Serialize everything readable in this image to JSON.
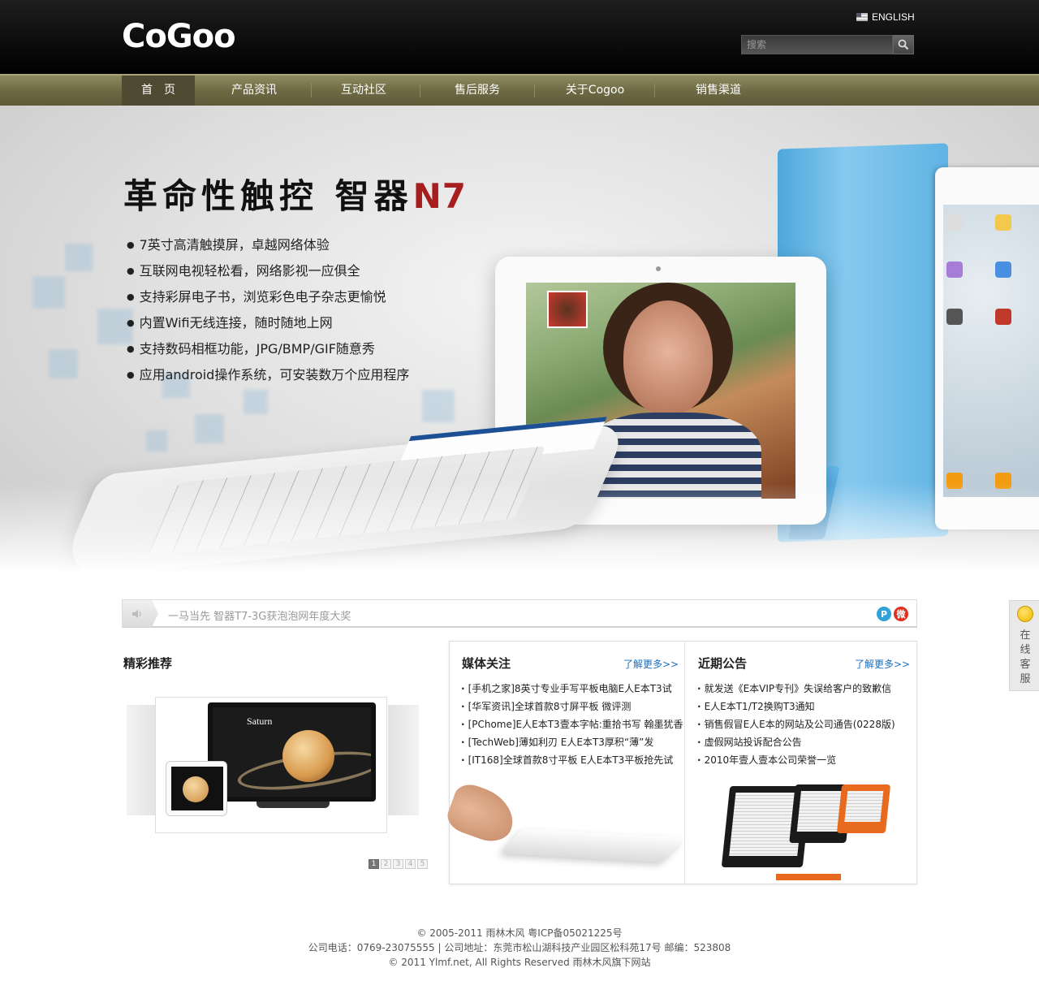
{
  "header": {
    "logo": "CoGoo",
    "language": "ENGLISH",
    "search_placeholder": "搜索"
  },
  "nav": {
    "items": [
      "首　页",
      "产品资讯",
      "互动社区",
      "售后服务",
      "关于Cogoo",
      "销售渠道"
    ],
    "active_index": 0
  },
  "banner": {
    "headline_main": "革命性触控 智器",
    "headline_model": "N7",
    "features": [
      "7英寸高清触摸屏，卓越网络体验",
      "互联网电视轻松看，网络影视一应俱全",
      "支持彩屏电子书，浏览彩色电子杂志更愉悦",
      "内置Wifi无线连接，随时随地上网",
      "支持数码相框功能，JPG/BMP/GIF随意秀",
      "应用android操作系统，可安装数万个应用程序"
    ],
    "slide_count": 3,
    "active_slide": 1
  },
  "ticker": {
    "text": "一马当先 智器T7-3G获泡泡网年度大奖"
  },
  "recommend": {
    "title": "精彩推荐",
    "image_label": "Saturn",
    "pages": [
      "1",
      "2",
      "3",
      "4",
      "5"
    ],
    "active_page": 1
  },
  "media": {
    "title": "媒体关注",
    "more": "了解更多>>",
    "items": [
      "[手机之家]8英寸专业手写平板电脑E人E本T3试",
      "[华军资讯]全球首款8寸屏平板 微评测",
      "[PChome]E人E本T3壹本字帖:重拾书写 翰墨犹香",
      "[TechWeb]薄如利刃 E人E本T3厚积“薄”发",
      "[IT168]全球首款8寸平板 E人E本T3平板抢先试"
    ]
  },
  "notices": {
    "title": "近期公告",
    "more": "了解更多>>",
    "items": [
      "就发送《E本VIP专刊》失误给客户的致歉信",
      "E人E本T1/T2换购T3通知",
      "销售假冒E人E本的网站及公司通告(0228版)",
      "虚假网站投诉配合公告",
      "2010年壹人壹本公司荣誉一览"
    ]
  },
  "side_service": {
    "label": "在线客服"
  },
  "footer": {
    "line1": "© 2005-2011 雨林木风 粤ICP备05021225号",
    "line2": "公司电话：0769-23075555 | 公司地址：东莞市松山湖科技产业园区松科苑17号 邮编：523808",
    "line3": "© 2011 Ylmf.net, All Rights Reserved 雨林木风旗下网站"
  },
  "colors": {
    "header_bg": "#000000",
    "nav_bg": "#6e6a44",
    "nav_active": "#4e4b32",
    "headline_accent": "#a81e1e",
    "link": "#1a6ec0"
  }
}
